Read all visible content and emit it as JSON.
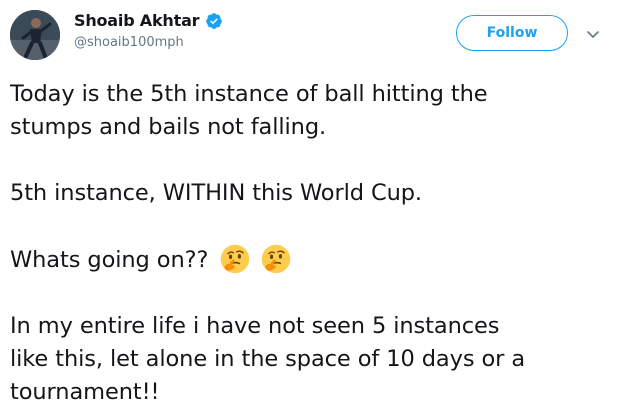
{
  "user": {
    "display_name": "Shoaib Akhtar",
    "handle": "@shoaib100mph",
    "verified": true
  },
  "actions": {
    "follow_label": "Follow",
    "more_icon": "chevron-down-icon"
  },
  "tweet": {
    "paragraphs": [
      {
        "lines": [
          "Today is the 5th instance of ball hitting the",
          "stumps and bails not falling."
        ]
      },
      {
        "lines": [
          "5th instance, WITHIN this World Cup."
        ]
      },
      {
        "text": "Whats going on??",
        "emoji": [
          "thinking-face-emoji",
          "thinking-face-emoji"
        ]
      },
      {
        "lines": [
          "In my entire life i have not seen 5 instances",
          "like this, let alone in the space of 10 days or a",
          "tournament!!"
        ]
      }
    ]
  },
  "colors": {
    "accent": "#1da1f2",
    "text": "#14171a",
    "secondary_text": "#657786",
    "emoji_face": "#ffcc4d"
  }
}
